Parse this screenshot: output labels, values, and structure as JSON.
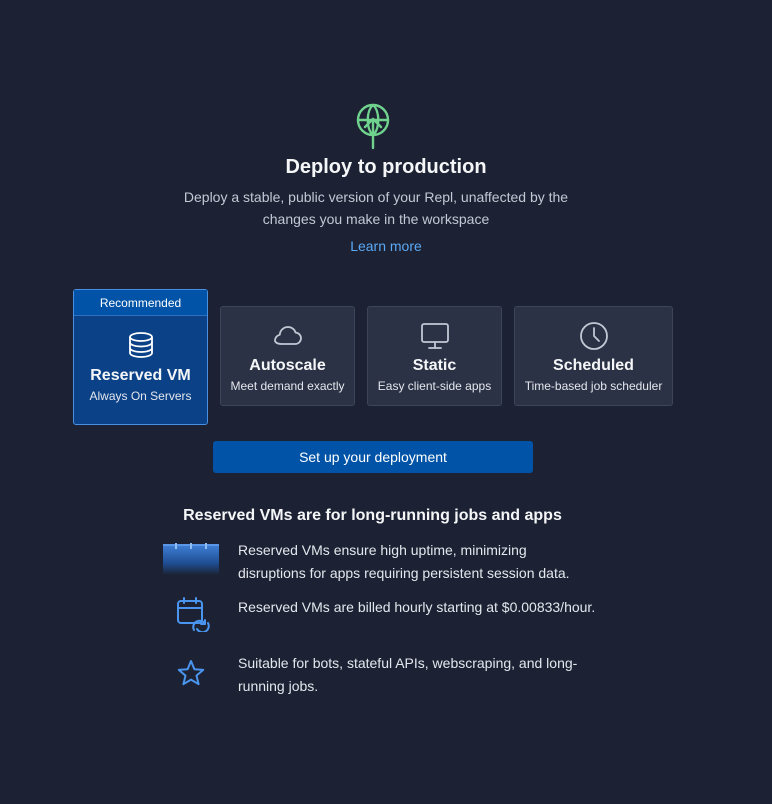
{
  "hero": {
    "icon": "antenna-upload-icon",
    "title": "Deploy to production",
    "subtitle": "Deploy a stable, public version of your Repl, unaffected by the changes you make in the workspace",
    "learn_more": "Learn more"
  },
  "options": [
    {
      "badge": "Recommended",
      "name": "Reserved VM",
      "desc": "Always On Servers",
      "icon": "database-icon",
      "selected": true
    },
    {
      "name": "Autoscale",
      "desc": "Meet demand exactly",
      "icon": "cloud-icon",
      "selected": false
    },
    {
      "name": "Static",
      "desc": "Easy client-side apps",
      "icon": "monitor-icon",
      "selected": false
    },
    {
      "name": "Scheduled",
      "desc": "Time-based job scheduler",
      "icon": "clock-icon",
      "selected": false
    }
  ],
  "cta": {
    "label": "Set up your deployment"
  },
  "info": {
    "title": "Reserved VMs are for long-running jobs and apps",
    "features": [
      {
        "icon": "uptime-bars-icon",
        "text": "Reserved VMs ensure high uptime, minimizing disruptions for apps requiring persistent session data."
      },
      {
        "icon": "calendar-refresh-icon",
        "text": "Reserved VMs are billed hourly starting at $0.00833/hour."
      },
      {
        "icon": "star-icon",
        "text": "Suitable for bots, stateful APIs, webscraping, and long-running jobs."
      }
    ]
  },
  "colors": {
    "background": "#1c2233",
    "card": "#2b3245",
    "selected_card": "#0a4187",
    "accent_blue": "#0053a6",
    "link": "#5ba8f5",
    "hero_icon_green": "#6fd38e"
  }
}
